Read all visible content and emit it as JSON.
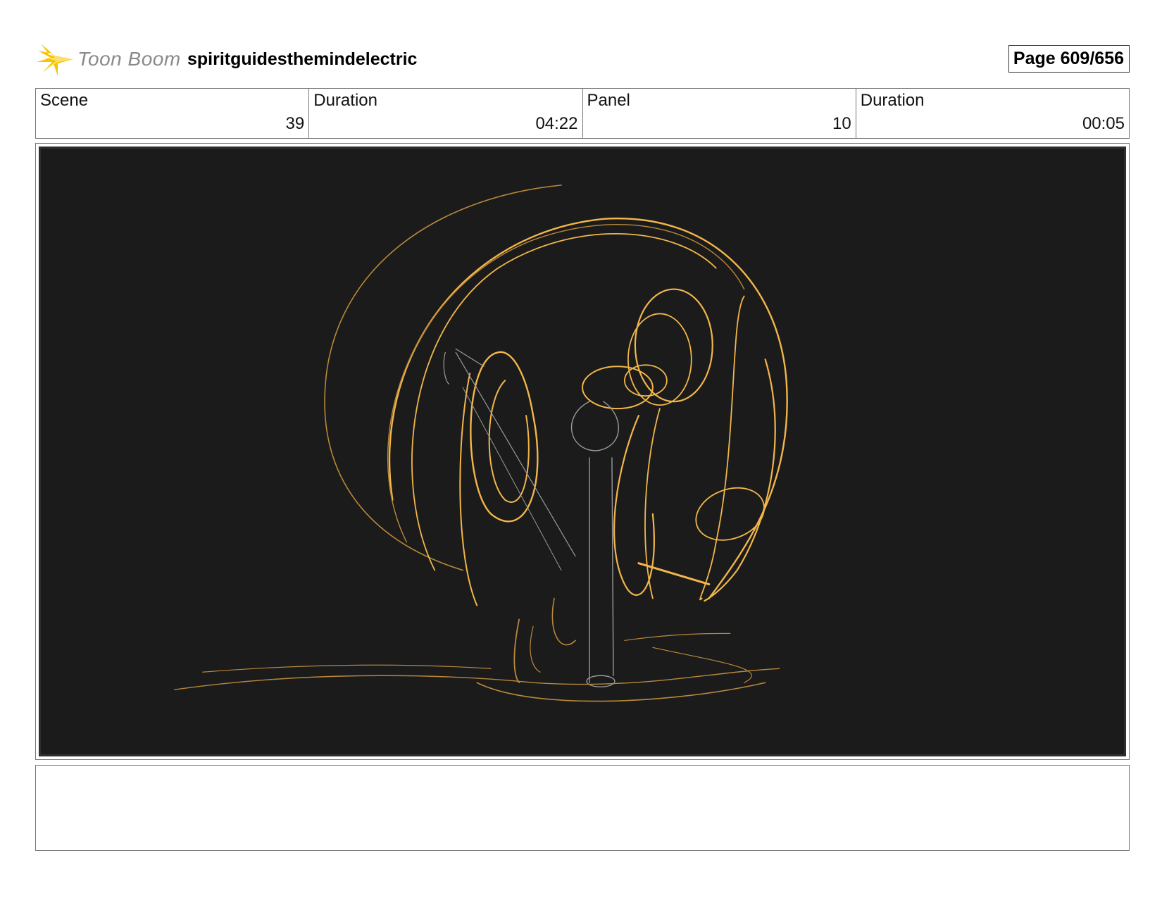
{
  "header": {
    "logo_text": "Toon Boom",
    "project_title": "spiritguidesthemindelectric",
    "page_label": "Page 609/656"
  },
  "info": {
    "scene_label": "Scene",
    "scene_value": "39",
    "scene_duration_label": "Duration",
    "scene_duration_value": "04:22",
    "panel_label": "Panel",
    "panel_value": "10",
    "panel_duration_label": "Duration",
    "panel_duration_value": "00:05"
  },
  "panel": {
    "background_color": "#1b1b1b",
    "sketch_colors": {
      "gold": "#f2b64a",
      "dim_gold": "#b8883a",
      "grey": "#9a9a9a"
    }
  },
  "notes": {
    "text": ""
  }
}
